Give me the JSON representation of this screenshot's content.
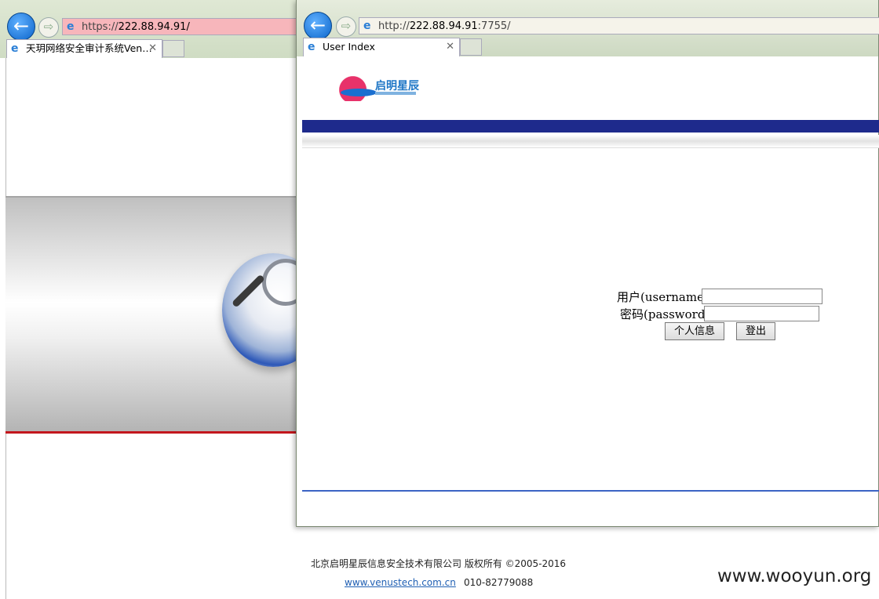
{
  "back_window": {
    "url_scheme": "https://",
    "url_host": "222.88.94.91/",
    "tab_title": "天玥网络安全审计系统Ven…",
    "footer_company": "北京启明星辰信息安全技术有限公司 版权所有 ©2005-2016",
    "footer_link": "www.venustech.com.cn",
    "footer_phone": "010-82779088"
  },
  "front_window": {
    "url_scheme": "http://",
    "url_host": "222.88.94.91",
    "url_rest": ":7755/",
    "tab_title": "User Index",
    "logo_text": "启明星辰",
    "form": {
      "username_label": "用户(username)",
      "username_value": "",
      "password_label": "密码(password)",
      "password_value": "",
      "profile_button": "个人信息",
      "logout_button": "登出"
    }
  },
  "icons": {
    "back": "back-arrow-icon",
    "forward": "forward-arrow-icon",
    "ie": "ie-logo-icon",
    "close_tab": "close-icon"
  },
  "colors": {
    "back_url_bar": "#f7b6bb",
    "nav_blue": "#0a63c9",
    "header_bar": "#1e2a8c",
    "banner_red": "#c3161c",
    "footer_link": "#1f5fb3"
  },
  "watermark": "www.wooyun.org"
}
